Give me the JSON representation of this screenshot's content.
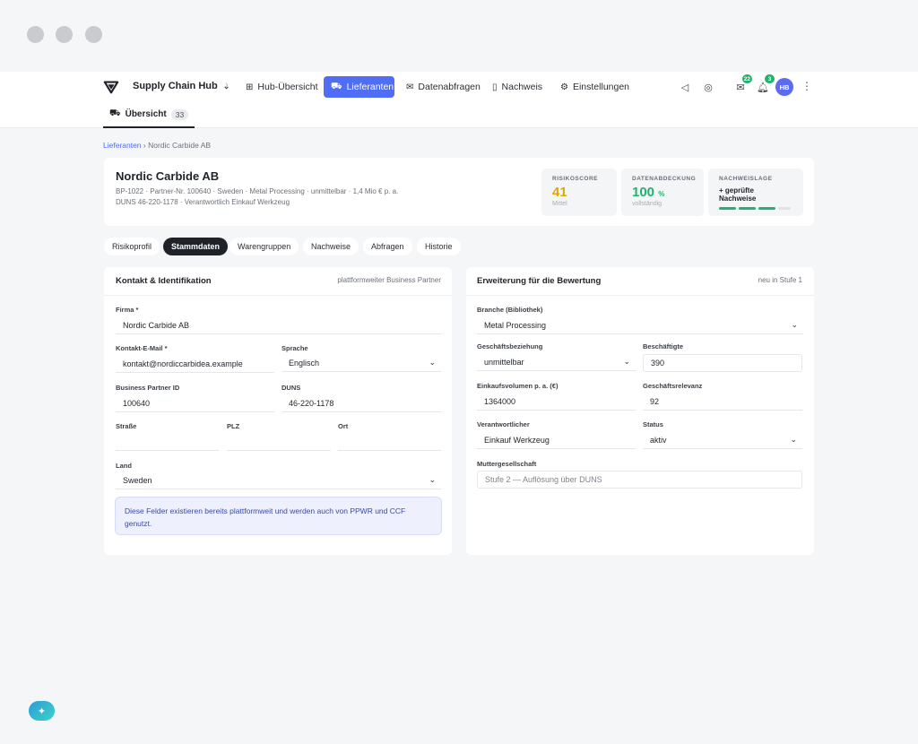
{
  "nav": {
    "brand": "Supply Chain Hub",
    "items": [
      {
        "label": "Hub-Übersicht",
        "icon": "grid-icon"
      },
      {
        "label": "Lieferanten",
        "icon": "truck-icon",
        "active": true
      },
      {
        "label": "Datenabfragen",
        "icon": "mail-icon"
      },
      {
        "label": "Nachweis",
        "icon": "document-icon"
      },
      {
        "label": "Einstellungen",
        "icon": "gear-icon"
      }
    ],
    "mail_badge": "22",
    "bell_badge": "3",
    "avatar": "HB"
  },
  "subnav": {
    "label": "Übersicht",
    "count": "33"
  },
  "breadcrumb": {
    "root": "Lieferanten",
    "current": "Nordic Carbide AB"
  },
  "header": {
    "company": "Nordic Carbide AB",
    "meta_line1": "BP-1022 · Partner-Nr. 100640 · Sweden · Metal Processing · unmittelbar · 1,4 Mio € p. a.",
    "meta_line2": "DUNS 46-220-1178 · Verantwortlich Einkauf Werkzeug",
    "risk": {
      "label": "RISIKOSCORE",
      "value": "41",
      "sub": "Mittel"
    },
    "coverage": {
      "label": "DATENABDECKUNG",
      "value": "100",
      "unit": "%",
      "sub": "vollständig"
    },
    "evidence": {
      "label": "NACHWEISLAGE",
      "text": "+ geprüfte Nachweise",
      "filled": 3,
      "total": 4
    }
  },
  "tabs": [
    "Risikoprofil",
    "Stammdaten",
    "Warengruppen",
    "Nachweise",
    "Abfragen",
    "Historie"
  ],
  "left": {
    "title": "Kontakt & Identifikation",
    "note": "plattformweiter Business Partner",
    "firma_label": "Firma *",
    "firma": "Nordic Carbide AB",
    "email_label": "Kontakt-E-Mail *",
    "email": "kontakt@nordiccarbidea.example",
    "sprache_label": "Sprache",
    "sprache": "Englisch",
    "bpid_label": "Business Partner ID",
    "bpid": "100640",
    "duns_label": "DUNS",
    "duns": "46-220-1178",
    "strasse_label": "Straße",
    "plz_label": "PLZ",
    "ort_label": "Ort",
    "land_label": "Land",
    "land": "Sweden",
    "info": "Diese Felder existieren bereits plattformweit und werden auch von PPWR und CCF genutzt."
  },
  "right": {
    "title": "Erweiterung für die Bewertung",
    "note": "neu in Stufe 1",
    "branche_label": "Branche (Bibliothek)",
    "branche": "Metal Processing",
    "beziehung_label": "Geschäftsbeziehung",
    "beziehung": "unmittelbar",
    "besch_label": "Beschäftigte",
    "besch": "390",
    "volumen_label": "Einkaufsvolumen p. a. (€)",
    "volumen": "1364000",
    "relevanz_label": "Geschäftsrelevanz",
    "relevanz": "92",
    "verantw_label": "Verantwortlicher",
    "verantw": "Einkauf Werkzeug",
    "status_label": "Status",
    "status": "aktiv",
    "mutter_label": "Muttergesellschaft",
    "mutter_placeholder": "Stufe 2 — Auflösung über DUNS"
  }
}
